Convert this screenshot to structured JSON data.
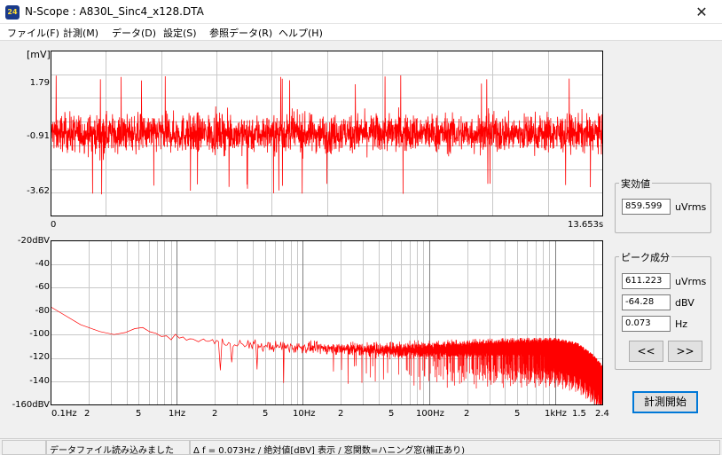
{
  "window": {
    "title": "N-Scope : A830L_Sinc4_x128.DTA",
    "icon_text": "24",
    "close_glyph": "✕"
  },
  "menu": {
    "items": [
      "ファイル(F)",
      "計測(M)",
      "データ(D)",
      "設定(S)",
      "参照データ(R)",
      "ヘルプ(H)"
    ]
  },
  "time_plot": {
    "unit_label": "[mV]",
    "y_ticks": [
      "1.79",
      "-0.91",
      "-3.62"
    ],
    "x_start": "0",
    "x_end": "13.653s",
    "trace_color": "#ff0000"
  },
  "spectrum_plot": {
    "y_ticks": [
      "-20dBV",
      "-40",
      "-60",
      "-80",
      "-100",
      "-120",
      "-140",
      "-160dBV"
    ],
    "x_ticks": [
      "0.1Hz",
      "2",
      "5",
      "1Hz",
      "2",
      "5",
      "10Hz",
      "2",
      "5",
      "100Hz",
      "2",
      "5",
      "1kHz",
      "1.5",
      "2.4"
    ],
    "trace_color": "#ff0000"
  },
  "rms_group": {
    "title": "実効値",
    "value": "859.599",
    "unit": "uVrms"
  },
  "peak_group": {
    "title": "ピーク成分",
    "uvrms_value": "611.223",
    "uvrms_unit": "uVrms",
    "dbv_value": "-64.28",
    "dbv_unit": "dBV",
    "hz_value": "0.073",
    "hz_unit": "Hz",
    "prev_label": "<<",
    "next_label": ">>"
  },
  "start_button": {
    "label": "計測開始"
  },
  "status": {
    "message": "データファイル読み込みました",
    "info": "Δ f = 0.073Hz / 絶対値[dBV] 表示 / 窓関数=ハニング窓(補正あり)"
  },
  "chart_data": [
    {
      "type": "line",
      "ylabel": "[mV]",
      "yticks": [
        1.79,
        -0.91,
        -3.62
      ],
      "ylim": [
        -4.975,
        3.145
      ],
      "xlim": [
        0,
        13.653
      ],
      "xticks": [
        "0",
        "13.653s"
      ],
      "grid": true,
      "series": [
        {
          "description_values": {
            "mean": -0.91,
            "typical_min": -3.2,
            "typical_max": 1.4,
            "peak_max": 2.1,
            "peak_min": -3.9
          }
        }
      ]
    },
    {
      "type": "line",
      "xscale": "log",
      "xlim": [
        0.1,
        2400
      ],
      "ylim": [
        -160,
        -20
      ],
      "yticks": [
        -20,
        -40,
        -60,
        -80,
        -100,
        -120,
        -140,
        -160
      ],
      "xticks": [
        "0.1Hz",
        "2",
        "5",
        "1Hz",
        "2",
        "5",
        "10Hz",
        "2",
        "5",
        "100Hz",
        "2",
        "5",
        "1kHz",
        "1.5",
        "2.4"
      ],
      "grid": true,
      "series": [
        {
          "x": [
            0.1,
            0.13,
            0.2,
            0.3,
            0.4,
            0.5,
            0.6,
            0.8,
            1,
            2,
            3,
            5,
            10,
            20,
            50,
            100,
            200,
            500,
            1000,
            1500,
            2000,
            2400
          ],
          "y": [
            -77,
            -85,
            -95,
            -100,
            -98,
            -93,
            -97,
            -102,
            -103,
            -106,
            -108,
            -110,
            -111,
            -112,
            -113,
            -113,
            -112,
            -111,
            -111,
            -115,
            -125,
            -135
          ]
        }
      ]
    }
  ]
}
